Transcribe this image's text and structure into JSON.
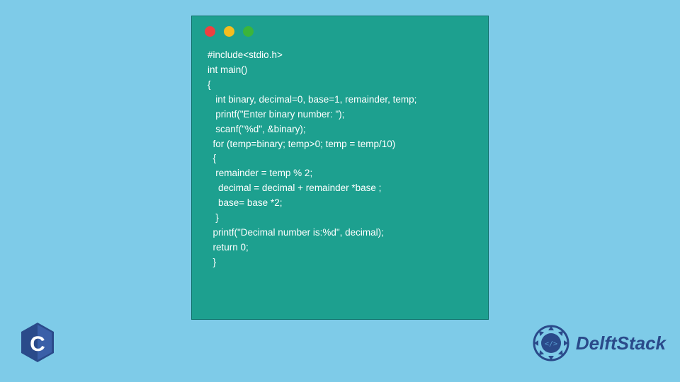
{
  "code": {
    "lines": [
      "#include<stdio.h>",
      "int main()",
      "{",
      "   int binary, decimal=0, base=1, remainder, temp;",
      "   printf(\"Enter binary number: \");",
      "   scanf(\"%d\", &binary);",
      "  for (temp=binary; temp>0; temp = temp/10)",
      "  {",
      "   remainder = temp % 2;",
      "    decimal = decimal + remainder *base ;",
      "    base= base *2;",
      "   }",
      "  printf(\"Decimal number is:%d\", decimal);",
      "  return 0;",
      "  }"
    ]
  },
  "logos": {
    "c_letter": "C",
    "delft_text": "DelftStack"
  },
  "colors": {
    "bg": "#7ecbe8",
    "window": "#1da08f",
    "code_text": "#ffffff",
    "delft_blue": "#2a4a8a"
  }
}
